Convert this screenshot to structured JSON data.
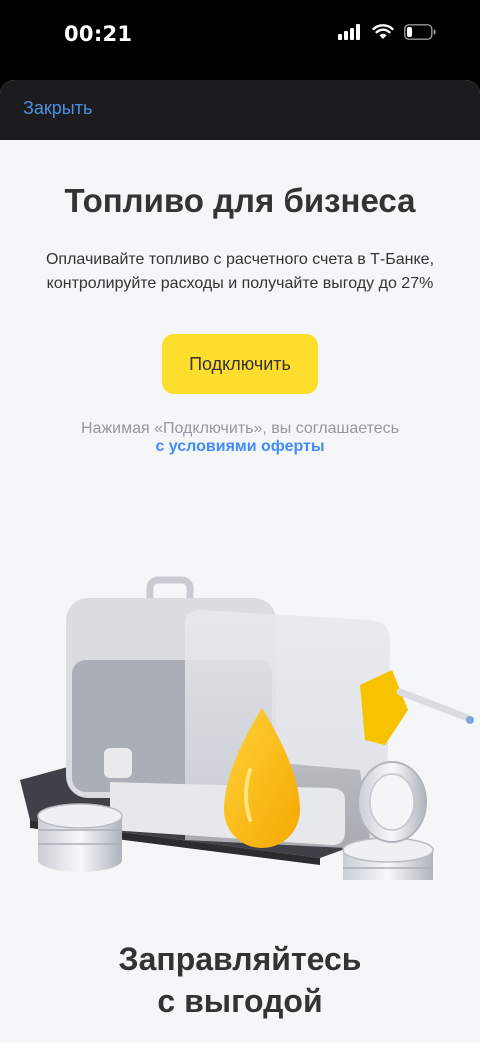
{
  "status_bar": {
    "time": "00:21",
    "icons": [
      "cellular-signal-icon",
      "wifi-icon",
      "battery-icon"
    ]
  },
  "header": {
    "close_label": "Закрыть"
  },
  "main": {
    "title": "Топливо для бизнеса",
    "subtitle_line1": "Оплачивайте топливо с расчетного счета в Т-Банке,",
    "subtitle_line2": "контролируйте расходы и получайте выгоду до 27%",
    "connect_label": "Подключить",
    "agreement_text": "Нажимая «Подключить», вы соглашаетесь",
    "offer_link": "с условиями оферты"
  },
  "section": {
    "title_line1": "Заправляйтесь",
    "title_line2": "с выгодой"
  },
  "colors": {
    "accent_yellow": "#ffdd2d",
    "link_blue": "#428bf9",
    "text_dark": "#333333",
    "text_gray": "#9299a2",
    "background": "#f5f6f8"
  }
}
